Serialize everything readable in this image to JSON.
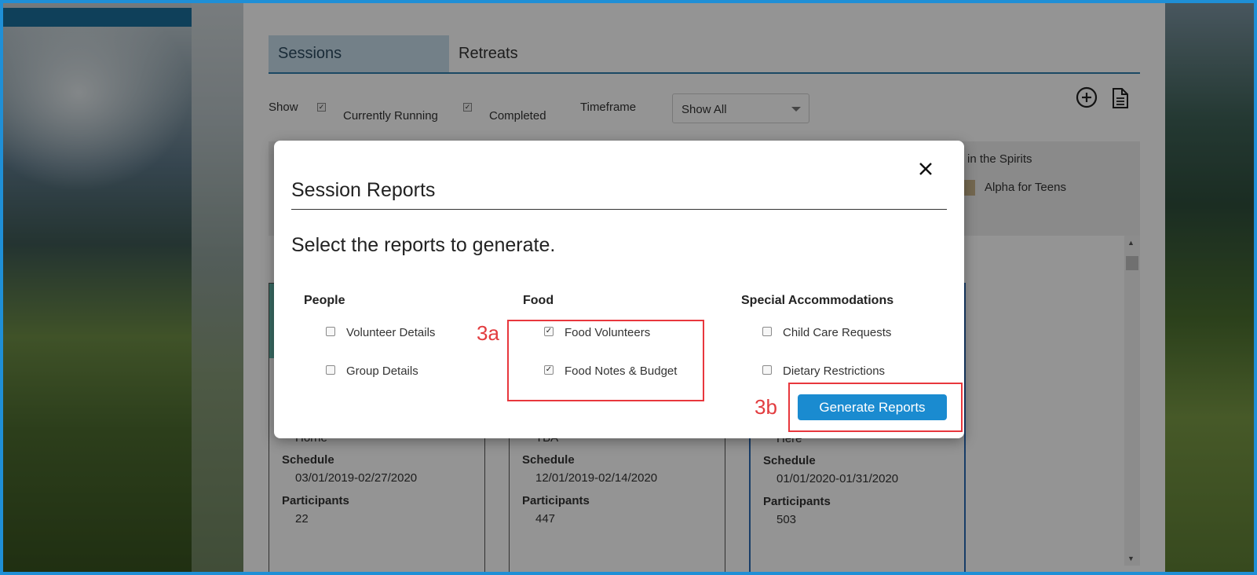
{
  "tabs": [
    {
      "label": "Sessions"
    },
    {
      "label": "Retreats"
    }
  ],
  "filters": {
    "show_label": "Show",
    "currently_running_label": "Currently Running",
    "completed_label": "Completed",
    "timeframe_label": "Timeframe",
    "timeframe_value": "Show All"
  },
  "legend": {
    "item1": "in the Spirits",
    "item2": "Alpha for Teens"
  },
  "cards": [
    {
      "location": "Horne",
      "schedule_label": "Schedule",
      "schedule": "03/01/2019-02/27/2020",
      "participants_label": "Participants",
      "participants": "22"
    },
    {
      "location": "TBA",
      "schedule_label": "Schedule",
      "schedule": "12/01/2019-02/14/2020",
      "participants_label": "Participants",
      "participants": "447"
    },
    {
      "location": "Here",
      "schedule_label": "Schedule",
      "schedule": "01/01/2020-01/31/2020",
      "participants_label": "Participants",
      "participants": "503"
    }
  ],
  "modal": {
    "title": "Session Reports",
    "subtitle": "Select the reports to generate.",
    "columns": [
      {
        "heading": "People",
        "options": [
          {
            "label": "Volunteer Details",
            "checked": false
          },
          {
            "label": "Group Details",
            "checked": false
          }
        ]
      },
      {
        "heading": "Food",
        "options": [
          {
            "label": "Food Volunteers",
            "checked": true
          },
          {
            "label": "Food Notes & Budget",
            "checked": true
          }
        ]
      },
      {
        "heading": "Special Accommodations",
        "options": [
          {
            "label": "Child Care Requests",
            "checked": false
          },
          {
            "label": "Dietary Restrictions",
            "checked": false
          }
        ]
      }
    ],
    "generate_label": "Generate Reports"
  },
  "annotations": {
    "a": "3a",
    "b": "3b"
  },
  "icons": [
    "close-icon",
    "add-circle-icon",
    "document-icon"
  ],
  "colors": {
    "accent": "#1a8bd0",
    "tab_active": "#c7dceb",
    "annotation": "#e8373d",
    "frame": "#1f8fd6"
  }
}
